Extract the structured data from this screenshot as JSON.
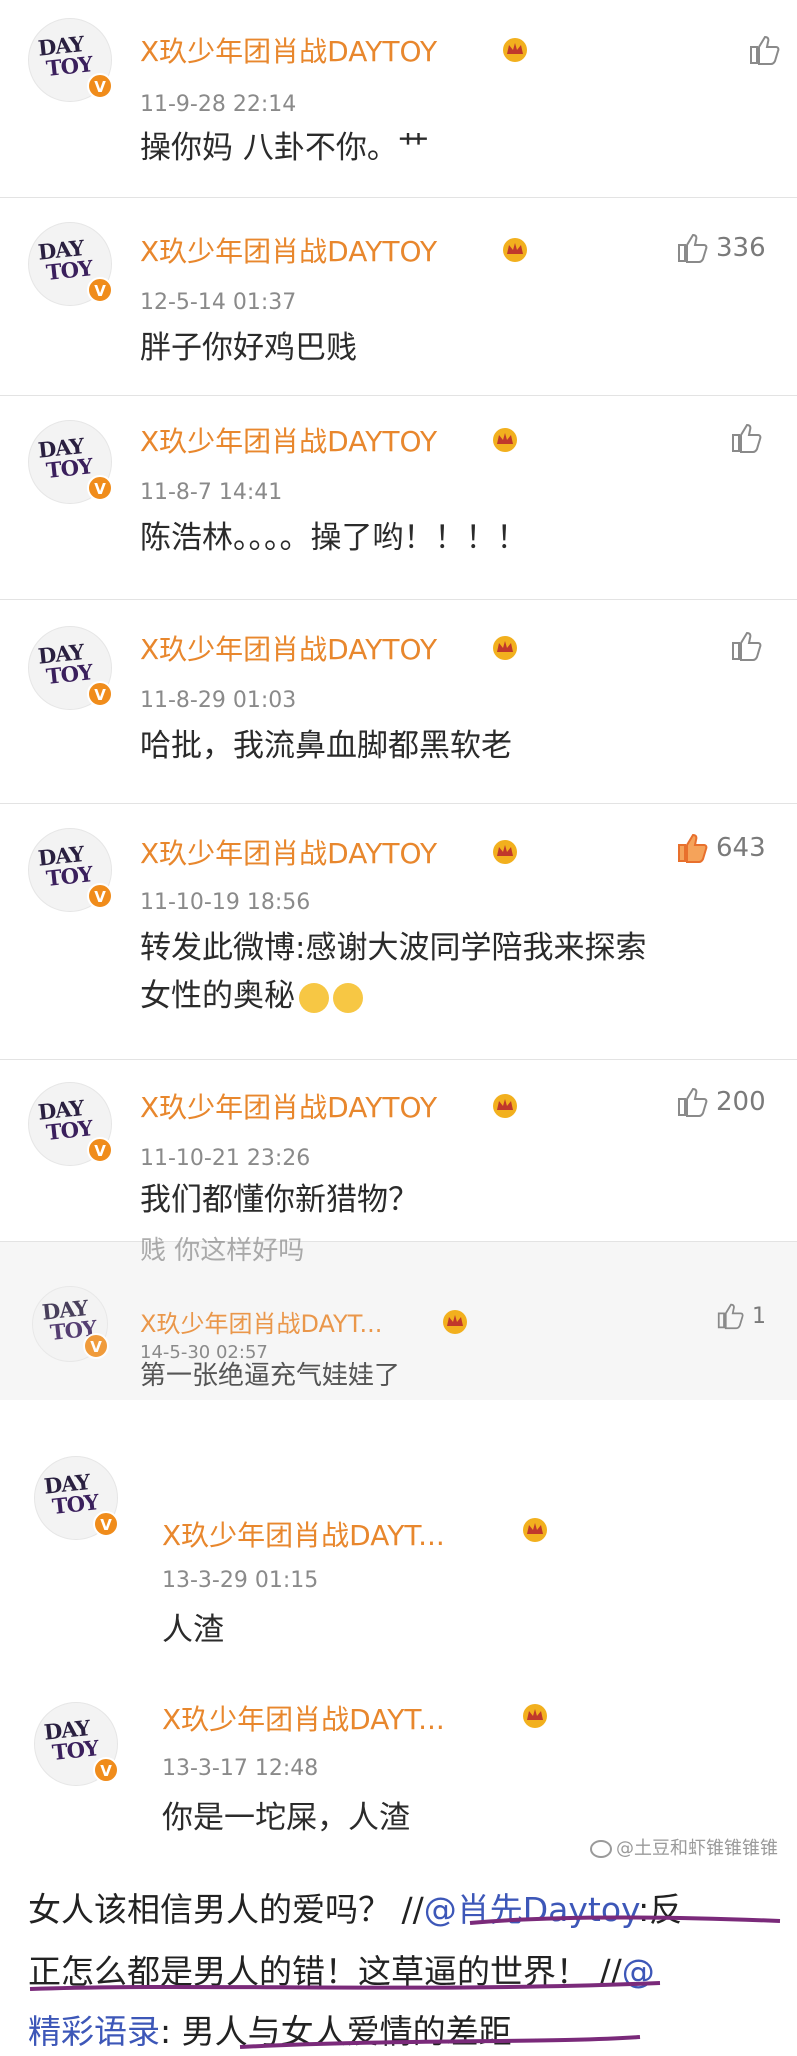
{
  "comments": [
    {
      "name": "X玖少年团肖战DAYTOY",
      "time": "11-9-28 22:14",
      "text": "操你妈  八卦不你。艹",
      "likes": ""
    },
    {
      "name": "X玖少年团肖战DAYTOY",
      "time": "12-5-14 01:37",
      "text": "胖子你好鸡巴贱",
      "likes": "336"
    },
    {
      "name": "X玖少年团肖战DAYTOY",
      "time": "11-8-7 14:41",
      "text": "陈浩林。。。。操了哟！！！！",
      "likes": ""
    },
    {
      "name": "X玖少年团肖战DAYTOY",
      "time": "11-8-29 01:03",
      "text": "哈批，我流鼻血脚都黑软老",
      "likes": ""
    },
    {
      "name": "X玖少年团肖战DAYTOY",
      "time": "11-10-19 18:56",
      "text": "转发此微博:感谢大波同学陪我来探索",
      "text2": "女性的奥秘",
      "likes": "643"
    },
    {
      "name": "X玖少年团肖战DAYTOY",
      "time": "11-10-21 23:26",
      "text": "我们都懂你新猎物？",
      "likes": "200"
    },
    {
      "partial_text": "贱 你这样好吗",
      "name": "X玖少年团肖战DAYT...",
      "time": "14-5-30 02:57",
      "text": "第一张绝逼充气娃娃了",
      "likes": "1"
    },
    {
      "name": "X玖少年团肖战DAYT...",
      "time": "13-3-29 01:15",
      "text": "人渣",
      "likes": ""
    },
    {
      "name": "X玖少年团肖战DAYT...",
      "time": "13-3-17 12:48",
      "text": "你是一坨屎，人渣",
      "likes": ""
    }
  ],
  "avatar": {
    "line1": "DAY",
    "line2": "TOY",
    "badge": "V"
  },
  "bottom": {
    "line1_a": "女人该相信男人的爱吗？ //",
    "line1_mention": "@肖先Daytoy",
    "line1_b": ":反",
    "line2_a": "正怎么都是男人的错！这草逼的世界！  //",
    "line2_mention": "@",
    "line3_mention": "精彩语录",
    "line3_b": ": 男人与女人爱情的差距"
  },
  "watermarks": {
    "right": "@土豆和虾锥锥锥锥"
  },
  "colors": {
    "name": "#e8872d",
    "like_active": "#e8702d",
    "mention": "#3d57b8",
    "underline": "#7a2a7a"
  }
}
